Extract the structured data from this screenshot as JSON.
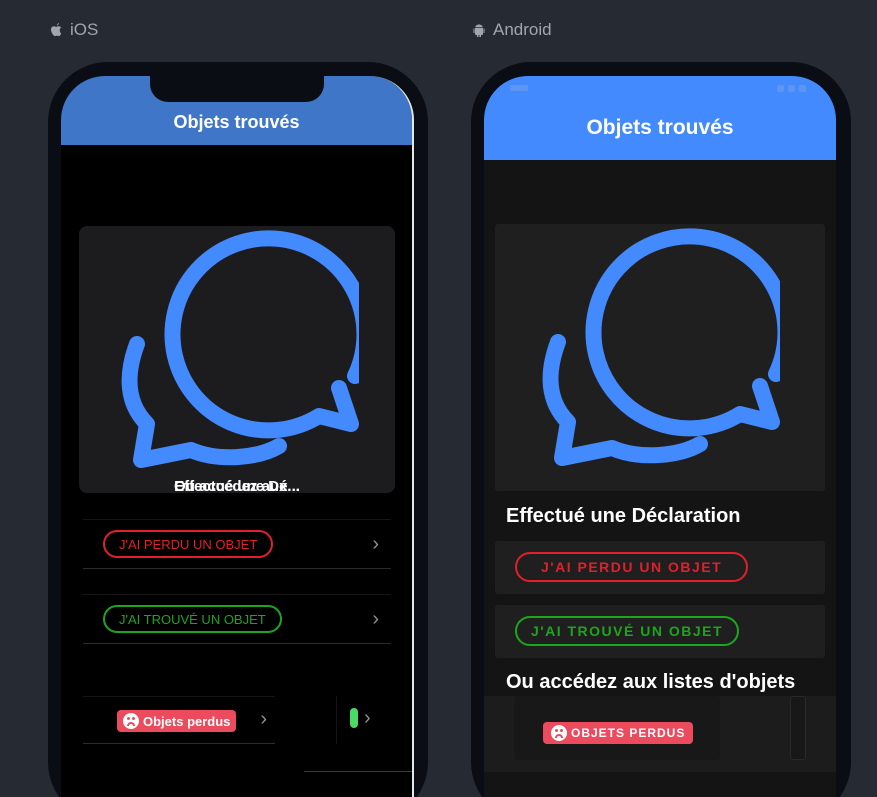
{
  "platforms": {
    "ios_label": "iOS",
    "android_label": "Android"
  },
  "ios": {
    "header_title": "Objets trouvés",
    "overlap_texts": [
      "Effectué une Dé...",
      "Ou accédez aux..."
    ],
    "lost_button": "J'AI PERDU UN OBJET",
    "found_button": "J'AI TROUVÉ UN OBJET",
    "lost_list_badge": "Objets perdus"
  },
  "android": {
    "header_title": "Objets trouvés",
    "declaration_heading": "Effectué une Déclaration",
    "lost_button": "J'AI PERDU UN OBJET",
    "found_button": "J'AI TROUVÉ UN OBJET",
    "lists_heading": "Ou accédez aux listes d'objets",
    "lost_list_badge": "OBJETS PERDUS"
  },
  "colors": {
    "ios_header": "#3f76c8",
    "android_header": "#448aff",
    "chat_icon": "#448aff",
    "lost_red": "#e0202a",
    "found_green": "#1ea51e",
    "badge_red": "#ec4b5e"
  },
  "icons": {
    "apple": "apple-icon",
    "android": "android-icon",
    "chat": "chat-bubbles-icon",
    "chevron": "chevron-right-icon",
    "sad_face": "sad-face-icon"
  }
}
